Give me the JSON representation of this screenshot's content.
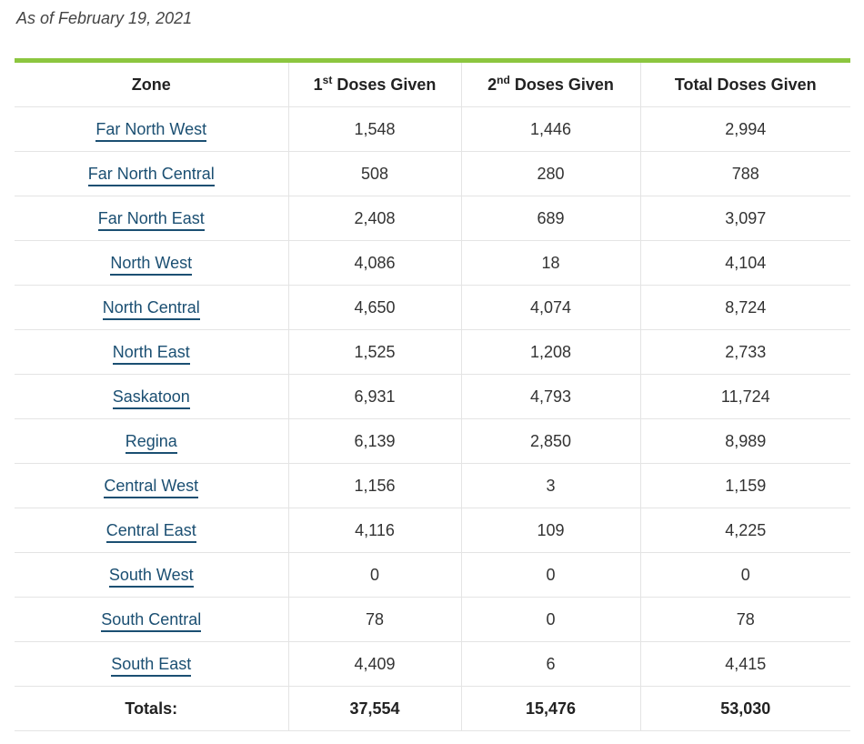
{
  "as_of": "As of February 19, 2021",
  "table": {
    "headers": {
      "zone": "Zone",
      "first_num": "1",
      "first_sup": "st",
      "first_rest": " Doses Given",
      "second_num": "2",
      "second_sup": "nd",
      "second_rest": " Doses Given",
      "total": "Total Doses Given"
    },
    "rows": [
      {
        "zone": "Far North West",
        "first": "1,548",
        "second": "1,446",
        "total": "2,994"
      },
      {
        "zone": "Far North Central",
        "first": "508",
        "second": "280",
        "total": "788"
      },
      {
        "zone": "Far North East",
        "first": "2,408",
        "second": "689",
        "total": "3,097"
      },
      {
        "zone": "North West",
        "first": "4,086",
        "second": "18",
        "total": "4,104"
      },
      {
        "zone": "North Central",
        "first": "4,650",
        "second": "4,074",
        "total": "8,724"
      },
      {
        "zone": "North East",
        "first": "1,525",
        "second": "1,208",
        "total": "2,733"
      },
      {
        "zone": "Saskatoon",
        "first": "6,931",
        "second": "4,793",
        "total": "11,724"
      },
      {
        "zone": "Regina",
        "first": "6,139",
        "second": "2,850",
        "total": "8,989"
      },
      {
        "zone": "Central West",
        "first": "1,156",
        "second": "3",
        "total": "1,159"
      },
      {
        "zone": "Central East",
        "first": "4,116",
        "second": "109",
        "total": "4,225"
      },
      {
        "zone": "South West",
        "first": "0",
        "second": "0",
        "total": "0"
      },
      {
        "zone": "South Central",
        "first": "78",
        "second": "0",
        "total": "78"
      },
      {
        "zone": "South East",
        "first": "4,409",
        "second": "6",
        "total": "4,415"
      }
    ],
    "totals": {
      "label": "Totals:",
      "first": "37,554",
      "second": "15,476",
      "total": "53,030"
    }
  },
  "colors": {
    "accent_rule": "#8cc63f",
    "link": "#1b4f72"
  }
}
